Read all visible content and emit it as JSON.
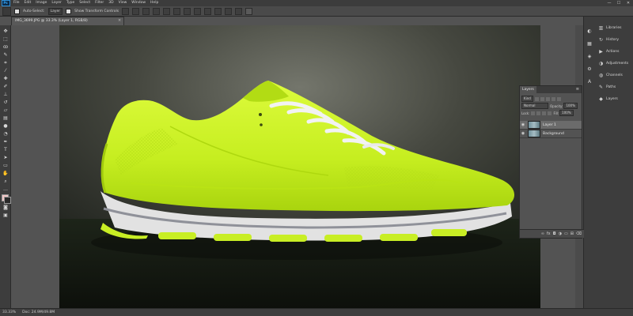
{
  "app": {
    "logo": "Ps"
  },
  "menu": [
    "File",
    "Edit",
    "Image",
    "Layer",
    "Type",
    "Select",
    "Filter",
    "3D",
    "View",
    "Window",
    "Help"
  ],
  "window_controls": [
    "—",
    "☐",
    "✕"
  ],
  "options_bar": {
    "auto_select_label": "Auto-Select:",
    "auto_select_value": "Layer",
    "show_transform_label": "Show Transform Controls"
  },
  "doc_tab": {
    "title": "IMG_3699.JPG @ 33.3% (Layer 1, RGB/8)",
    "close": "×"
  },
  "status_bar": {
    "zoom": "33.33%",
    "doc": "Doc: 24.9M/49.8M"
  },
  "right_panels": [
    {
      "label": "Libraries",
      "icon": "libraries-icon"
    },
    {
      "label": "History",
      "icon": "history-icon"
    },
    {
      "label": "Actions",
      "icon": "actions-icon"
    },
    {
      "label": "Adjustments",
      "icon": "adjustments-icon"
    },
    {
      "label": "Channels",
      "icon": "channels-icon"
    },
    {
      "label": "Paths",
      "icon": "paths-icon"
    },
    {
      "label": "Layers",
      "icon": "layers-icon"
    }
  ],
  "layers_panel": {
    "tab": "Layers",
    "menu": "≡",
    "filter_label": "Kind",
    "blend_mode": "Normal",
    "opacity_label": "Opacity:",
    "opacity_value": "100%",
    "lock_label": "Lock:",
    "fill_label": "Fill:",
    "fill_value": "100%",
    "layers": [
      {
        "name": "Layer 1",
        "visible": true,
        "selected": true
      },
      {
        "name": "Background",
        "visible": true,
        "selected": false
      }
    ],
    "footer_icons": [
      "link-icon",
      "fx-icon",
      "mask-icon",
      "adjustment-icon",
      "folder-icon",
      "new-layer-icon",
      "trash-icon"
    ]
  },
  "colors": {
    "shoe_body": "#c7f227",
    "shoe_sole": "#dcdcdc",
    "background_dark": "#1e211c",
    "ui_dark": "#3d3d3d"
  }
}
